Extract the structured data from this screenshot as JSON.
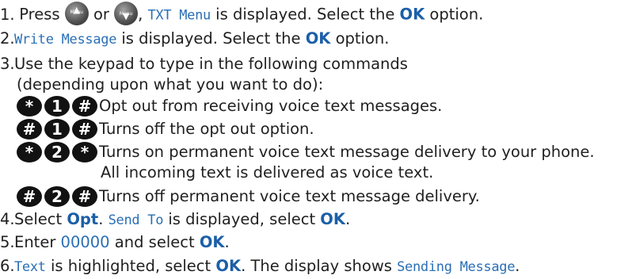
{
  "steps": [
    {
      "n": "1.",
      "t1": "Press ",
      "menu_up_label": "Menu",
      "t2": " or ",
      "menu_down_label": "Menu",
      "t3": ", ",
      "lcd1": "TXT Menu",
      "t4": " is displayed. Select the ",
      "ok": "OK",
      "t5": " option."
    },
    {
      "n": "2.",
      "lcd1": "Write Message",
      "t1": " is displayed. Select the ",
      "ok": "OK",
      "t2": " option."
    },
    {
      "n": "3.",
      "t1": "Use the keypad to type in the following commands",
      "t2": "(depending upon what you want to do):"
    },
    {
      "n": "4.",
      "t1": "Select ",
      "opt": "Opt",
      "t2": ". ",
      "lcd1": "Send To",
      "t3": " is displayed, select ",
      "ok": "OK",
      "t4": "."
    },
    {
      "n": "5.",
      "t1": "Enter ",
      "code": "00000",
      "t2": " and select ",
      "ok": "OK",
      "t3": "."
    },
    {
      "n": "6.",
      "lcd1": "Text",
      "t1": " is highlighted, select ",
      "ok": "OK",
      "t2": ". The display shows ",
      "lcd2": "Sending Message",
      "t3": "."
    }
  ],
  "commands": [
    {
      "keys": [
        "*",
        "1",
        "#"
      ],
      "desc": "Opt out from receiving voice text messages."
    },
    {
      "keys": [
        "#",
        "1",
        "#"
      ],
      "desc": "Turns off the opt out option."
    },
    {
      "keys": [
        "*",
        "2",
        "*"
      ],
      "desc": "Turns on permanent voice text message delivery to your phone.",
      "desc2": "All incoming text is delivered as voice text."
    },
    {
      "keys": [
        "#",
        "2",
        "#"
      ],
      "desc": "Turns off permanent voice text message delivery."
    }
  ]
}
